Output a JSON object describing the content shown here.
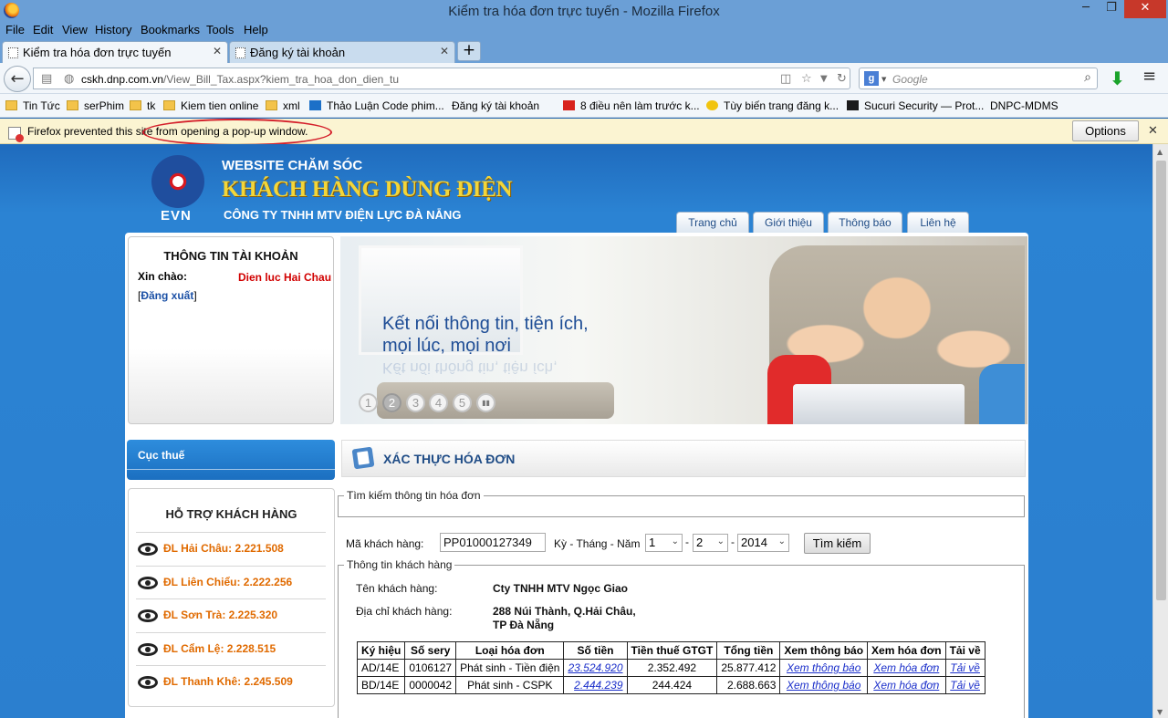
{
  "window": {
    "title": "Kiểm tra hóa đơn trực tuyến - Mozilla Firefox",
    "controls": {
      "minimize": "─",
      "maximize": "❐",
      "close": "✕"
    }
  },
  "menubar": [
    "File",
    "Edit",
    "View",
    "History",
    "Bookmarks",
    "Tools",
    "Help"
  ],
  "tabs": [
    {
      "label": "Kiểm tra hóa đơn trực tuyến",
      "active": true
    },
    {
      "label": "Đăng ký tài khoản",
      "active": false
    }
  ],
  "newtab_label": "+",
  "navbar": {
    "url_host": "cskh.dnp.com.vn",
    "url_path": "/View_Bill_Tax.aspx?kiem_tra_hoa_don_dien_tu",
    "search_engine": "g",
    "search_placeholder": "Google"
  },
  "bookmarks": [
    {
      "label": "Tin Tức",
      "icon": "folder"
    },
    {
      "label": "serPhim",
      "icon": "folder"
    },
    {
      "label": "tk",
      "icon": "folder"
    },
    {
      "label": "Kiem tien online",
      "icon": "folder"
    },
    {
      "label": "xml",
      "icon": "folder"
    },
    {
      "label": "Thảo Luận Code phim...",
      "icon": "blue"
    },
    {
      "label": "Đăng ký tài khoản",
      "icon": "page"
    },
    {
      "label": "8 điều nên làm trước k...",
      "icon": "red"
    },
    {
      "label": "Tùy biến trang đăng k...",
      "icon": "star"
    },
    {
      "label": "Sucuri Security — Prot...",
      "icon": "blk"
    },
    {
      "label": "DNPC-MDMS",
      "icon": "page"
    }
  ],
  "popup_bar": {
    "message": "Firefox prevented this site from opening a pop-up window.",
    "options": "Options",
    "close": "✕"
  },
  "header": {
    "logo_text": "EVN",
    "line1": "WEBSITE CHĂM SÓC",
    "line2": "KHÁCH HÀNG DÙNG ĐIỆN",
    "line3": "CÔNG TY TNHH MTV ĐIỆN LỰC ĐÀ NẴNG",
    "nav": [
      "Trang chủ",
      "Giới thiệu",
      "Thông báo",
      "Liên hệ"
    ]
  },
  "account": {
    "title": "THÔNG TIN TÀI KHOẢN",
    "hello": "Xin chào:",
    "user": "Dien luc Hai Chau",
    "logout_open": "[",
    "logout": "Đăng xuất",
    "logout_close": "]"
  },
  "banner": {
    "tagline1": "Kết nối thông tin, tiện ích,",
    "tagline2": "mọi lúc, mọi nơi",
    "reflection": "Kết nối thông tin, tiện ích,",
    "slides": [
      "1",
      "2",
      "3",
      "4",
      "5"
    ],
    "active_slide": "2",
    "pause": "▮▮"
  },
  "sidebar": {
    "cuc_thue": "Cục thuế",
    "support_title": "HỖ TRỢ KHÁCH HÀNG",
    "support_items": [
      "ĐL Hải Châu: 2.221.508",
      "ĐL Liên Chiểu: 2.222.256",
      "ĐL Sơn Trà: 2.225.320",
      "ĐL Cẩm Lệ: 2.228.515",
      "ĐL Thanh Khê: 2.245.509"
    ]
  },
  "main": {
    "title": "XÁC THỰC HÓA ĐƠN",
    "search_legend": "Tìm kiếm thông tin hóa đơn",
    "customer_code_label": "Mã khách hàng:",
    "customer_code_value": "PP01000127349",
    "period_label": "Kỳ - Tháng - Năm",
    "period": "1",
    "month": "2",
    "year": "2014",
    "dash": "-",
    "search_button": "Tìm kiếm",
    "info_legend": "Thông tin khách hàng",
    "customer_name_label": "Tên khách hàng:",
    "customer_name": "Cty TNHH MTV Ngọc Giao",
    "address_label": "Địa chỉ khách hàng:",
    "address_line1": "288 Núi Thành, Q.Hải Châu,",
    "address_line2": "TP Đà Nẵng"
  },
  "bills": {
    "headers": [
      "Ký hiệu",
      "Số sery",
      "Loại hóa đơn",
      "Số tiền",
      "Tiền thuế GTGT",
      "Tổng tiền",
      "Xem thông báo",
      "Xem hóa đơn",
      "Tải về"
    ],
    "rows": [
      [
        "AD/14E",
        "0106127",
        "Phát sinh - Tiền điện",
        "23.524.920",
        "2.352.492",
        "25.877.412",
        "Xem thông báo",
        "Xem hóa đơn",
        "Tải về"
      ],
      [
        "BD/14E",
        "0000042",
        "Phát sinh - CSPK",
        "2.444.239",
        "244.424",
        "2.688.663",
        "Xem thông báo",
        "Xem hóa đơn",
        "Tải về"
      ]
    ]
  },
  "colors": {
    "brand_blue": "#1f6bbd",
    "accent_orange": "#e06a00",
    "alert_red": "#d41e2a"
  }
}
